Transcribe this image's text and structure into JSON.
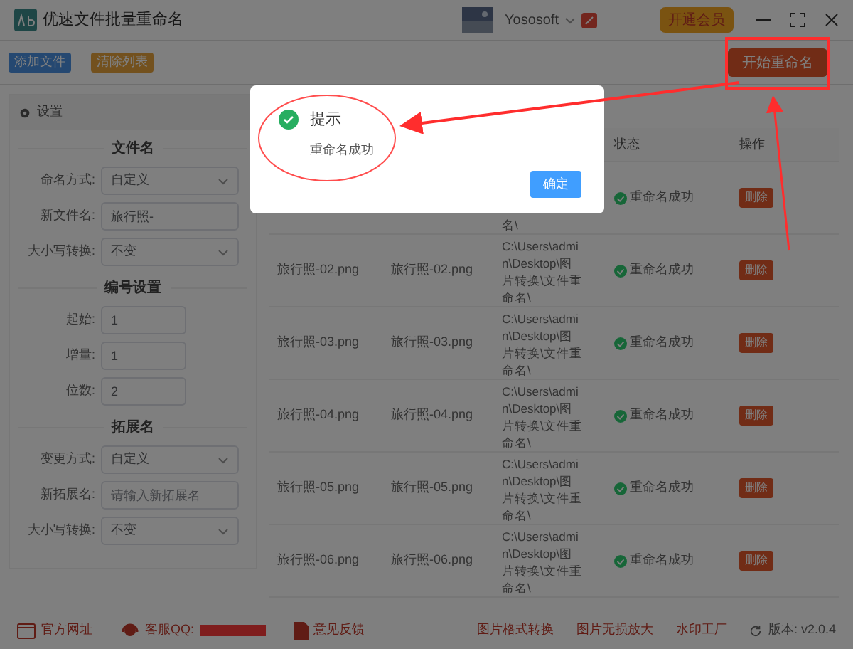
{
  "window": {
    "title": "优速文件批量重命名",
    "user": "Yososoft",
    "vip_button": "开通会员"
  },
  "toolbar": {
    "buttons": [
      {
        "label": "添加文件",
        "kind": "blue"
      },
      {
        "label": "清除列表",
        "kind": "amber"
      }
    ],
    "start_button": "开始重命名"
  },
  "settings": {
    "title": "设置",
    "sections": [
      {
        "heading": "文件名",
        "fields": [
          {
            "label": "命名方式:",
            "kind": "select",
            "value": "自定义"
          },
          {
            "label": "新文件名:",
            "kind": "input",
            "value": "旅行照-"
          },
          {
            "label": "大小写转换:",
            "kind": "select",
            "value": "不变"
          }
        ]
      },
      {
        "heading": "编号设置",
        "fields": [
          {
            "label": "起始:",
            "kind": "number",
            "value": "1"
          },
          {
            "label": "增量:",
            "kind": "number",
            "value": "1"
          },
          {
            "label": "位数:",
            "kind": "number",
            "value": "2"
          }
        ]
      },
      {
        "heading": "拓展名",
        "fields": [
          {
            "label": "变更方式:",
            "kind": "select",
            "value": "自定义"
          },
          {
            "label": "新拓展名:",
            "kind": "input",
            "placeholder": "请输入新拓展名"
          },
          {
            "label": "大小写转换:",
            "kind": "select",
            "value": "不变"
          }
        ]
      }
    ]
  },
  "table": {
    "columns": [
      {
        "label": "状态"
      },
      {
        "label": "操作"
      }
    ],
    "rows": [
      {
        "path": "名\\",
        "status": "重命名成功",
        "action": "删除"
      },
      {
        "original": "旅行照-02.png",
        "new_name": "旅行照-02.png",
        "path": "C:\\Users\\admin\\Desktop\\图片转换\\文件重命名\\",
        "status": "重命名成功",
        "action": "删除"
      },
      {
        "original": "旅行照-03.png",
        "new_name": "旅行照-03.png",
        "path": "C:\\Users\\admin\\Desktop\\图片转换\\文件重命名\\",
        "status": "重命名成功",
        "action": "删除"
      },
      {
        "original": "旅行照-04.png",
        "new_name": "旅行照-04.png",
        "path": "C:\\Users\\admin\\Desktop\\图片转换\\文件重命名\\",
        "status": "重命名成功",
        "action": "删除"
      },
      {
        "original": "旅行照-05.png",
        "new_name": "旅行照-05.png",
        "path": "C:\\Users\\admin\\Desktop\\图片转换\\文件重命名\\",
        "status": "重命名成功",
        "action": "删除"
      },
      {
        "original": "旅行照-06.png",
        "new_name": "旅行照-06.png",
        "path": "C:\\Users\\admin\\Desktop\\图片转换\\文件重命名\\",
        "status": "重命名成功",
        "action": "删除"
      }
    ]
  },
  "footer": {
    "left": [
      {
        "label": "官方网址",
        "kind": "web"
      },
      {
        "label": "客服QQ:",
        "kind": "qq"
      },
      {
        "label": "意见反馈",
        "kind": "pdf"
      }
    ],
    "right": [
      "图片格式转换",
      "图片无损放大",
      "水印工厂"
    ],
    "version": "版本: v2.0.4"
  },
  "dialog": {
    "title": "提示",
    "message": "重命名成功",
    "ok_button": "确定"
  }
}
